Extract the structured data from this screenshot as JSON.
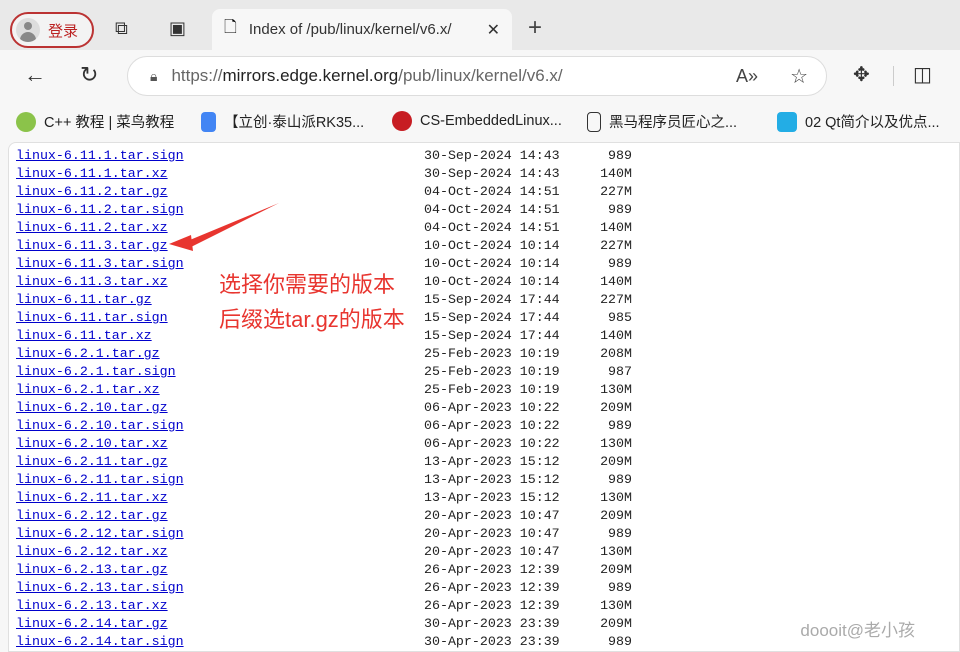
{
  "tabbar": {
    "login": "登录",
    "tab_title": "Index of /pub/linux/kernel/v6.x/",
    "close": "✕",
    "new_tab": "+"
  },
  "address": {
    "url_prefix": "https://",
    "url_host": "mirrors.edge.kernel.org",
    "url_path": "/pub/linux/kernel/v6.x/"
  },
  "bookmarks": [
    {
      "label": "C++ 教程 | 菜鸟教程",
      "icon": "runoob-icon",
      "color": "#8bc34a"
    },
    {
      "label": "【立创·泰山派RK35...",
      "icon": "docs-icon",
      "color": "#4285f4"
    },
    {
      "label": "CS-EmbeddedLinux...",
      "icon": "gitee-icon",
      "color": "#c71d23"
    },
    {
      "label": "黑马程序员匠心之...",
      "icon": "page-icon",
      "color": "#333333"
    },
    {
      "label": "02 Qt简介以及优点...",
      "icon": "bilibili-icon",
      "color": "#23ade5"
    }
  ],
  "files": [
    [
      "linux-6.11.1.tar.sign",
      "30-Sep-2024 14:43",
      "989"
    ],
    [
      "linux-6.11.1.tar.xz",
      "30-Sep-2024 14:43",
      "140M"
    ],
    [
      "linux-6.11.2.tar.gz",
      "04-Oct-2024 14:51",
      "227M"
    ],
    [
      "linux-6.11.2.tar.sign",
      "04-Oct-2024 14:51",
      "989"
    ],
    [
      "linux-6.11.2.tar.xz",
      "04-Oct-2024 14:51",
      "140M"
    ],
    [
      "linux-6.11.3.tar.gz",
      "10-Oct-2024 10:14",
      "227M"
    ],
    [
      "linux-6.11.3.tar.sign",
      "10-Oct-2024 10:14",
      "989"
    ],
    [
      "linux-6.11.3.tar.xz",
      "10-Oct-2024 10:14",
      "140M"
    ],
    [
      "linux-6.11.tar.gz",
      "15-Sep-2024 17:44",
      "227M"
    ],
    [
      "linux-6.11.tar.sign",
      "15-Sep-2024 17:44",
      "985"
    ],
    [
      "linux-6.11.tar.xz",
      "15-Sep-2024 17:44",
      "140M"
    ],
    [
      "linux-6.2.1.tar.gz",
      "25-Feb-2023 10:19",
      "208M"
    ],
    [
      "linux-6.2.1.tar.sign",
      "25-Feb-2023 10:19",
      "987"
    ],
    [
      "linux-6.2.1.tar.xz",
      "25-Feb-2023 10:19",
      "130M"
    ],
    [
      "linux-6.2.10.tar.gz",
      "06-Apr-2023 10:22",
      "209M"
    ],
    [
      "linux-6.2.10.tar.sign",
      "06-Apr-2023 10:22",
      "989"
    ],
    [
      "linux-6.2.10.tar.xz",
      "06-Apr-2023 10:22",
      "130M"
    ],
    [
      "linux-6.2.11.tar.gz",
      "13-Apr-2023 15:12",
      "209M"
    ],
    [
      "linux-6.2.11.tar.sign",
      "13-Apr-2023 15:12",
      "989"
    ],
    [
      "linux-6.2.11.tar.xz",
      "13-Apr-2023 15:12",
      "130M"
    ],
    [
      "linux-6.2.12.tar.gz",
      "20-Apr-2023 10:47",
      "209M"
    ],
    [
      "linux-6.2.12.tar.sign",
      "20-Apr-2023 10:47",
      "989"
    ],
    [
      "linux-6.2.12.tar.xz",
      "20-Apr-2023 10:47",
      "130M"
    ],
    [
      "linux-6.2.13.tar.gz",
      "26-Apr-2023 12:39",
      "209M"
    ],
    [
      "linux-6.2.13.tar.sign",
      "26-Apr-2023 12:39",
      "989"
    ],
    [
      "linux-6.2.13.tar.xz",
      "26-Apr-2023 12:39",
      "130M"
    ],
    [
      "linux-6.2.14.tar.gz",
      "30-Apr-2023 23:39",
      "209M"
    ],
    [
      "linux-6.2.14.tar.sign",
      "30-Apr-2023 23:39",
      "989"
    ]
  ],
  "annotation": {
    "line1": "选择你需要的版本",
    "line2": "后缀选tar.gz的版本",
    "color": "#e8352f"
  },
  "watermark": "doooit@老小孩"
}
